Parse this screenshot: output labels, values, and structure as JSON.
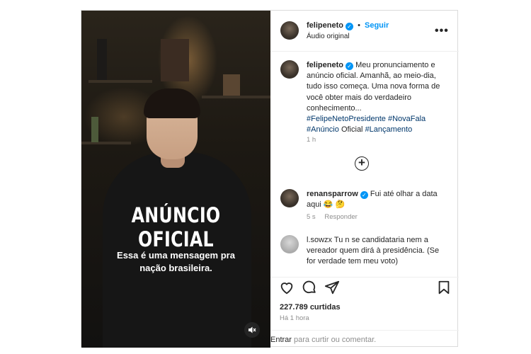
{
  "media": {
    "headline": "ANÚNCIO OFICIAL",
    "subline": "Essa é uma mensagem pra nação brasileira.",
    "mute_icon": "speaker-muted-icon"
  },
  "header": {
    "username": "felipeneto",
    "separator": "•",
    "follow": "Seguir",
    "audio": "Áudio original",
    "more": "•••"
  },
  "caption": {
    "username": "felipeneto",
    "text": "Meu pronunciamento e anúncio oficial. Amanhã, ao meio-dia, tudo isso começa. Uma nova forma de você obter mais do verdadeiro conhecimento...",
    "tag1": "#FelipeNetoPresidente",
    "tag2": "#NovaFala",
    "tag3": "#Anúncio",
    "word": "Oficial",
    "tag4": "#Lançamento",
    "time": "1 h"
  },
  "comments": [
    {
      "username": "renansparrow",
      "text": "Fui até olhar a data aqui 😂 🤔",
      "time": "5 s",
      "reply": "Responder"
    },
    {
      "username": "l.sowzx",
      "text": "Tu n se candidataria nem a vereador quem dirá à presidência. (Se for verdade tem meu voto)"
    }
  ],
  "likes": "227.789 curtidas",
  "post_time": "Há 1 hora",
  "add_comment": {
    "enter": "Entrar",
    "rest": " para curtir ou comentar."
  },
  "colors": {
    "accent": "#0095f6",
    "hashtag": "#00376b"
  }
}
